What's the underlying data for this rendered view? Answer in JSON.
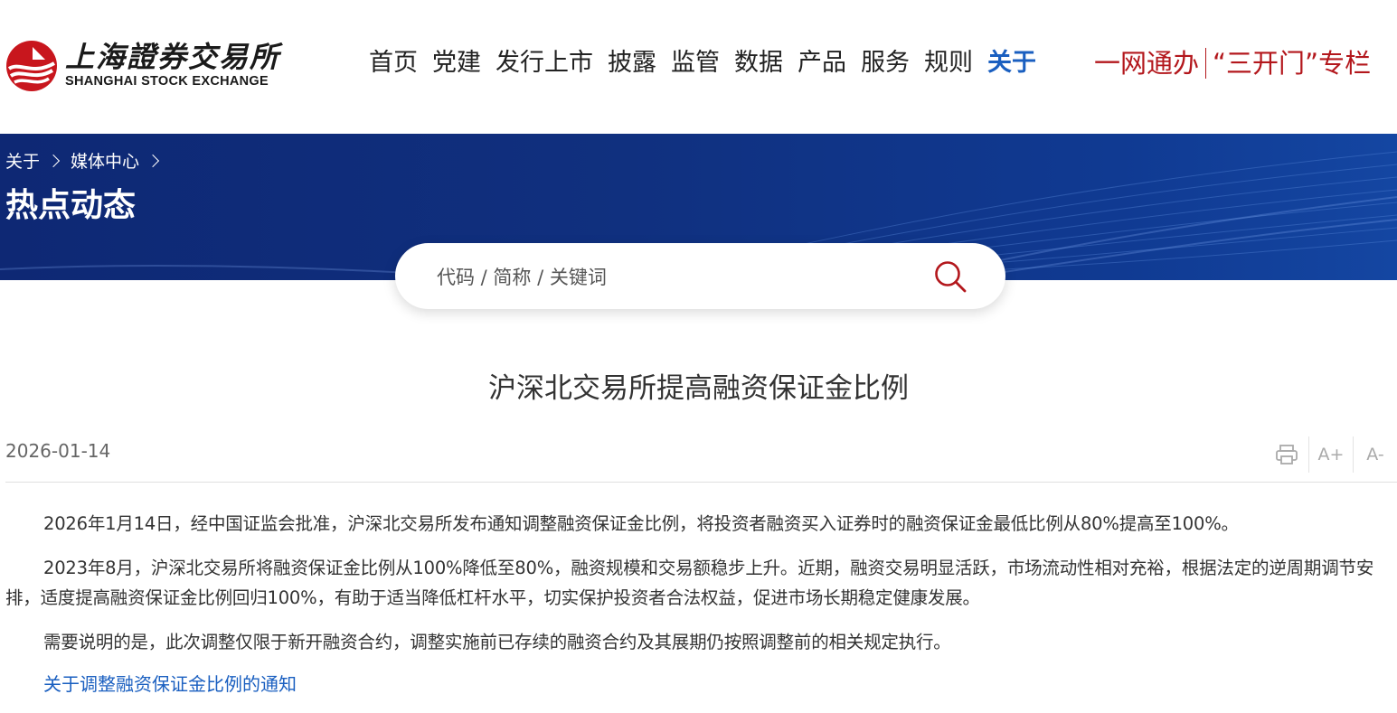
{
  "header": {
    "logo_cn": "上海證券交易所",
    "logo_en": "SHANGHAI STOCK EXCHANGE",
    "nav": [
      {
        "label": "首页"
      },
      {
        "label": "党建"
      },
      {
        "label": "发行上市"
      },
      {
        "label": "披露"
      },
      {
        "label": "监管"
      },
      {
        "label": "数据"
      },
      {
        "label": "产品"
      },
      {
        "label": "服务"
      },
      {
        "label": "规则"
      },
      {
        "label": "关于",
        "active": true
      }
    ],
    "special_links": [
      "一网通办",
      "“三开门”专栏"
    ]
  },
  "banner": {
    "breadcrumb": [
      "关于",
      "媒体中心"
    ],
    "title": "热点动态"
  },
  "search": {
    "placeholder": "代码 / 简称 / 关键词"
  },
  "article": {
    "title": "沪深北交易所提高融资保证金比例",
    "date": "2026-01-14",
    "tools": {
      "print_icon": "printer-icon",
      "font_increase": "A+",
      "font_decrease": "A-"
    },
    "paragraphs": [
      "2026年1月14日，经中国证监会批准，沪深北交易所发布通知调整融资保证金比例，将投资者融资买入证券时的融资保证金最低比例从80%提高至100%。",
      "2023年8月，沪深北交易所将融资保证金比例从100%降低至80%，融资规模和交易额稳步上升。近期，融资交易明显活跃，市场流动性相对充裕，根据法定的逆周期调节安排，适度提高融资保证金比例回归100%，有助于适当降低杠杆水平，切实保护投资者合法权益，促进市场长期稳定健康发展。",
      "需要说明的是，此次调整仅限于新开融资合约，调整实施前已存续的融资合约及其展期仍按照调整前的相关规定执行。"
    ],
    "attachment_link": "关于调整融资保证金比例的通知"
  },
  "colors": {
    "brand_red": "#b3171c",
    "nav_active": "#1a5fc0",
    "banner_blue": "#10307f",
    "link_blue": "#1a5fc0"
  }
}
